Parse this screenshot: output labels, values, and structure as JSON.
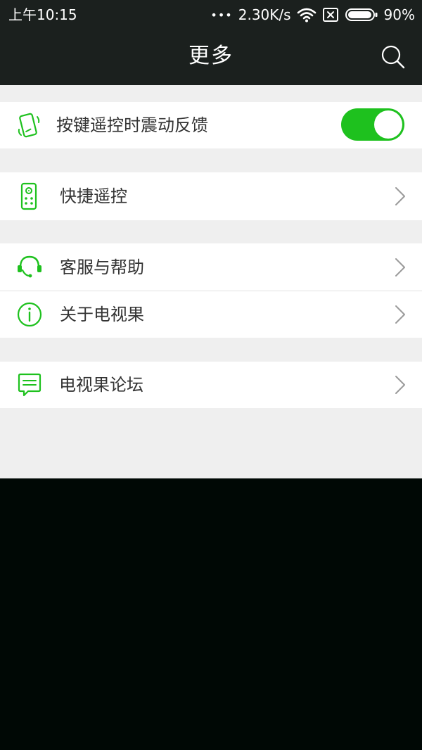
{
  "status_bar": {
    "time": "上午10:15",
    "signal_dots": "•••",
    "net_speed": "2.30K/s",
    "battery_percent": "90%",
    "icons": [
      "wifi-icon",
      "sim-none-icon",
      "battery-icon"
    ]
  },
  "header": {
    "title": "更多",
    "search_icon": "search-icon"
  },
  "settings": {
    "vibration": {
      "icon": "phone-vibrate-icon",
      "label": "按键遥控时震动反馈",
      "toggle_on": true
    },
    "quick_remote": {
      "icon": "remote-control-icon",
      "label": "快捷遥控"
    },
    "support": {
      "icon": "headset-icon",
      "label": "客服与帮助"
    },
    "about": {
      "icon": "info-icon",
      "label": "关于电视果"
    },
    "forum": {
      "icon": "chat-bubble-icon",
      "label": "电视果论坛"
    }
  },
  "colors": {
    "accent": "#1ec11e",
    "header_bg": "#1b201e",
    "page_bg": "#efefef",
    "row_bg": "#ffffff",
    "text": "#333333"
  }
}
